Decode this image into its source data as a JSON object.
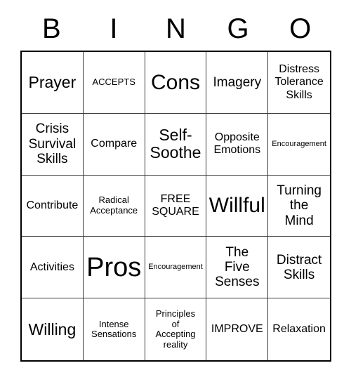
{
  "card": {
    "header_letters": [
      "B",
      "I",
      "N",
      "G",
      "O"
    ],
    "columns": 5,
    "rows": 5,
    "background_color": "#ffffff",
    "border_color": "#000000",
    "gridline_color": "#3a3a3a",
    "text_color": "#000000"
  },
  "cells": [
    {
      "text": "Prayer",
      "size": "xl"
    },
    {
      "text": "ACCEPTS",
      "size": "sm"
    },
    {
      "text": "Cons",
      "size": "2xl"
    },
    {
      "text": "Imagery",
      "size": "lg"
    },
    {
      "text": "Distress\nTolerance\nSkills",
      "size": "md"
    },
    {
      "text": "Crisis\nSurvival\nSkills",
      "size": "lg"
    },
    {
      "text": "Compare",
      "size": "md"
    },
    {
      "text": "Self-\nSoothe",
      "size": "xl"
    },
    {
      "text": "Opposite\nEmotions",
      "size": "md"
    },
    {
      "text": "Encouragement",
      "size": "xs"
    },
    {
      "text": "Contribute",
      "size": "md"
    },
    {
      "text": "Radical\nAcceptance",
      "size": "sm"
    },
    {
      "text": "FREE\nSQUARE",
      "size": "md"
    },
    {
      "text": "Willful",
      "size": "2xl"
    },
    {
      "text": "Turning\nthe\nMind",
      "size": "lg"
    },
    {
      "text": "Activities",
      "size": "md"
    },
    {
      "text": "Pros",
      "size": "3xl"
    },
    {
      "text": "Encouragement",
      "size": "xs"
    },
    {
      "text": "The\nFive\nSenses",
      "size": "lg"
    },
    {
      "text": "Distract\nSkills",
      "size": "lg"
    },
    {
      "text": "Willing",
      "size": "xl"
    },
    {
      "text": "Intense\nSensations",
      "size": "sm"
    },
    {
      "text": "Principles\nof\nAccepting\nreality",
      "size": "sm"
    },
    {
      "text": "IMPROVE",
      "size": "md"
    },
    {
      "text": "Relaxation",
      "size": "md"
    }
  ]
}
